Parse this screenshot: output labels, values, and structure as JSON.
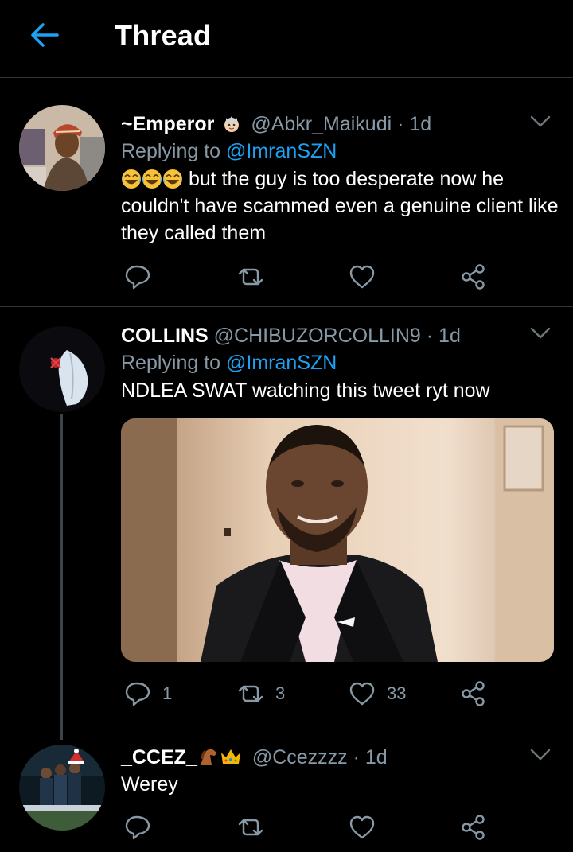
{
  "header": {
    "title": "Thread"
  },
  "tweets": [
    {
      "name": "~Emperor",
      "handle": "@Abkr_Maikudi",
      "time": "· 1d",
      "replying_prefix": "Replying to",
      "replying_to": "@ImranSZN",
      "text": "but the guy is too desperate now he couldn't have scammed even a genuine client like they called them",
      "reply_count": "",
      "retweet_count": "",
      "like_count": ""
    },
    {
      "name": "COLLINS",
      "handle": "@CHIBUZORCOLLIN9",
      "time": "· 1d",
      "replying_prefix": "Replying to",
      "replying_to": "@ImranSZN",
      "text": "NDLEA SWAT watching this tweet ryt now",
      "reply_count": "1",
      "retweet_count": "3",
      "like_count": "33"
    },
    {
      "name": "_CCEZ_",
      "handle": "@Ccezzzz",
      "time": "· 1d",
      "text": "Werey",
      "reply_count": "",
      "retweet_count": "",
      "like_count": ""
    }
  ],
  "colors": {
    "accent": "#1da1f2",
    "secondary": "#8899a6",
    "divider": "#2f3336"
  },
  "icons": [
    "back-arrow-icon",
    "chevron-down-icon",
    "reply-icon",
    "retweet-icon",
    "like-icon",
    "share-icon"
  ]
}
